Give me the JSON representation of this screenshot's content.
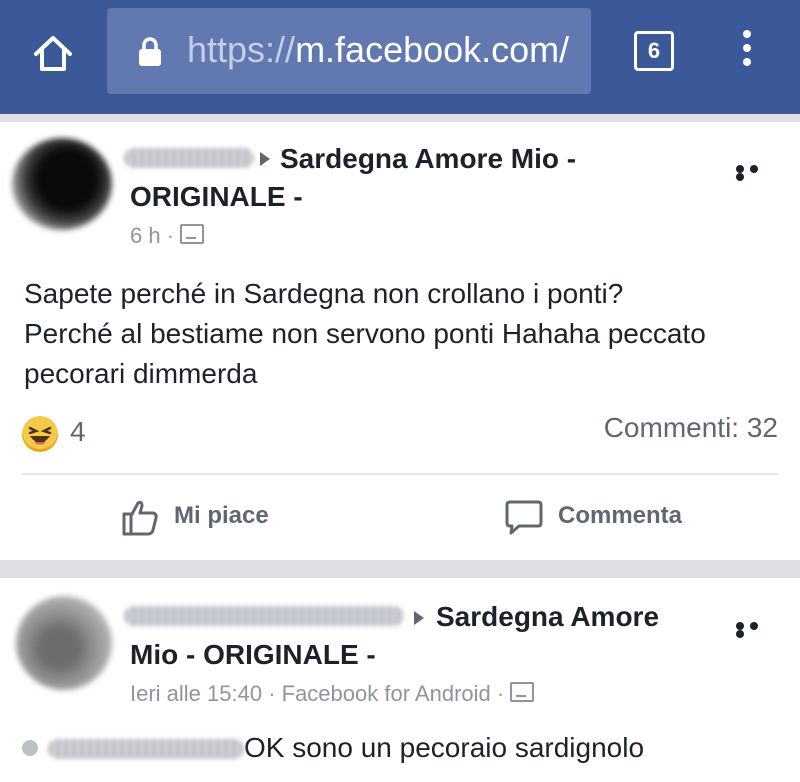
{
  "browser": {
    "url_scheme": "https://",
    "url_host": "m.facebook.com/",
    "tab_count": "6",
    "bar_color": "#3b5998"
  },
  "post1": {
    "group_name_line1": "Sardegna Amore Mio -",
    "group_name_line2": "ORIGINALE -",
    "time": "6 h ·",
    "text_line1": "Sapete perché in Sardegna non crollano i ponti?",
    "text_line2": "Perché al bestiame non servono ponti Hahaha peccato",
    "text_line3": "pecorari dimmerda",
    "reaction_icon": "haha-emoji-icon",
    "reaction_count": "4",
    "comments_label": "Commenti: 32",
    "like_label": "Mi piace",
    "comment_label": "Commenta"
  },
  "post2": {
    "group_name_line1": "Sardegna Amore",
    "group_name_line2": "Mio - ORIGINALE -",
    "time": "Ieri alle 15:40 · Facebook for Android ·",
    "comment_text": "OK sono un pecoraio sardignolo"
  }
}
